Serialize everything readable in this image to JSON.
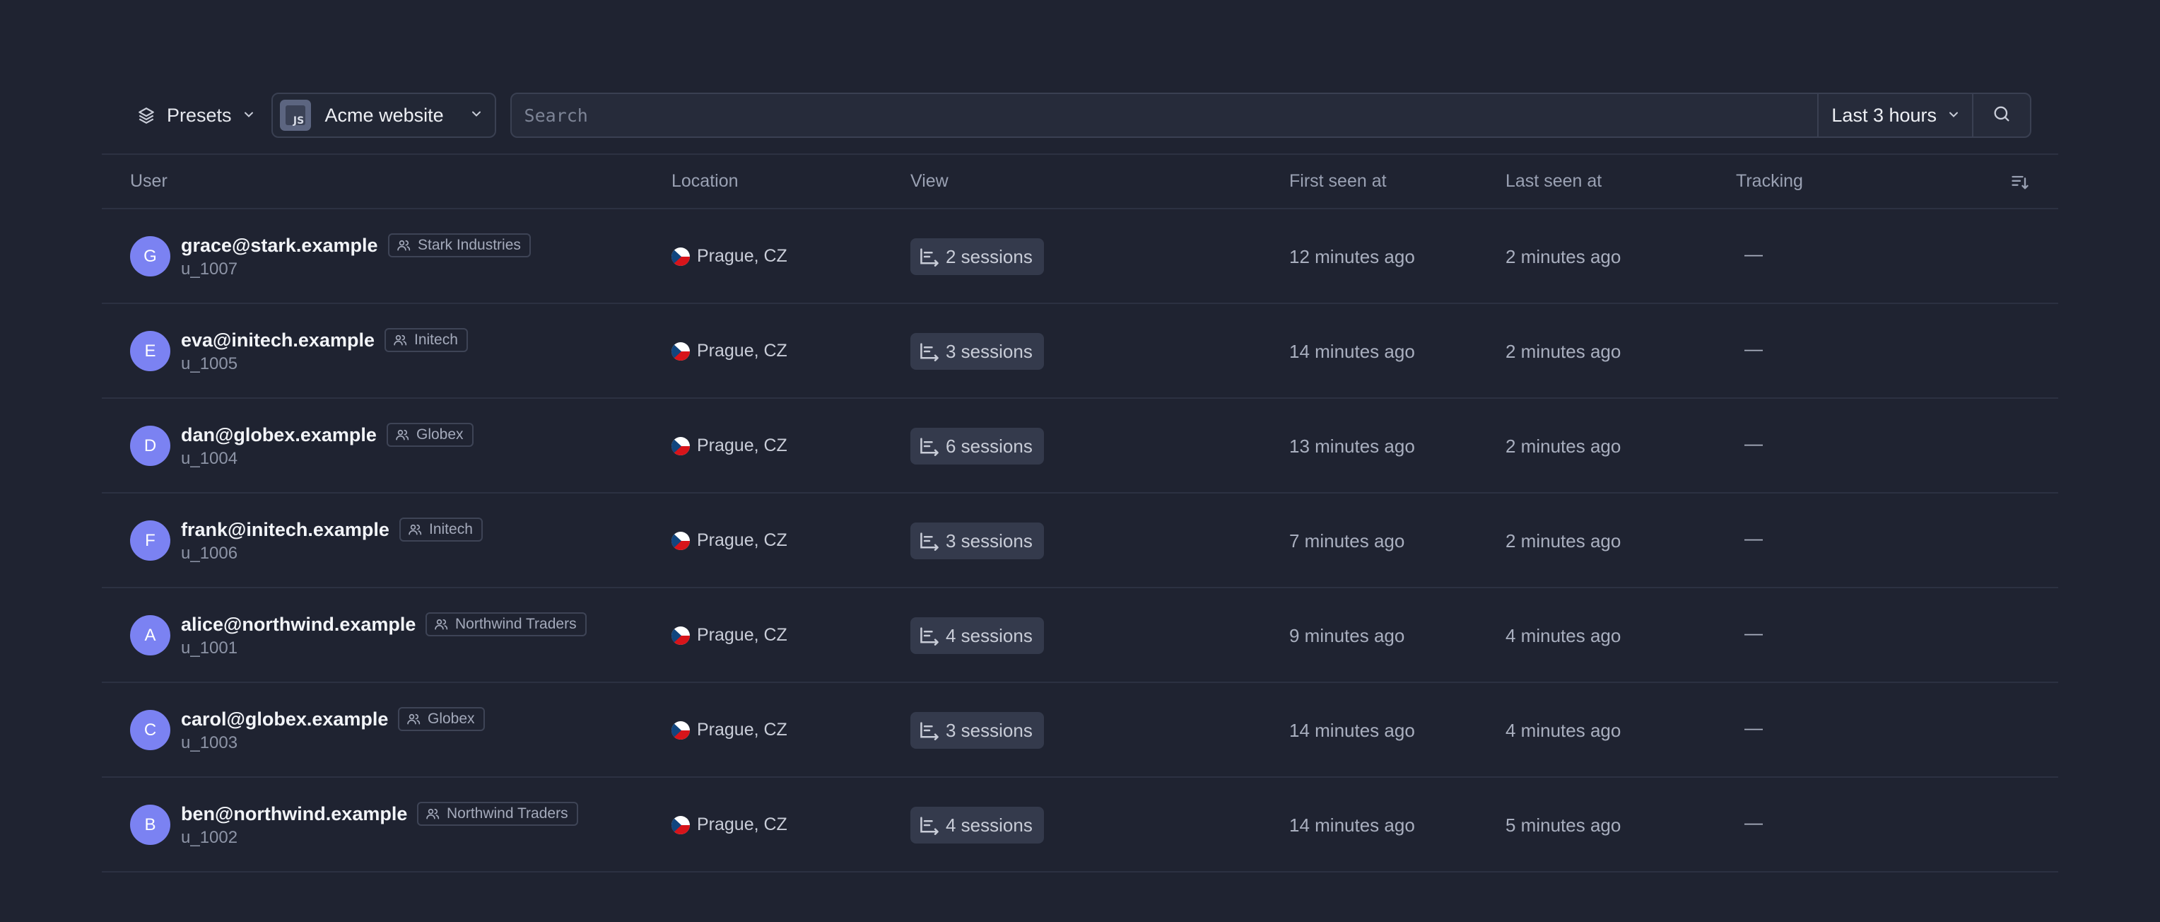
{
  "toolbar": {
    "presets_label": "Presets",
    "project_name": "Acme website",
    "project_logo_text": "JS",
    "search_placeholder": "Search",
    "time_range": "Last 3 hours"
  },
  "table": {
    "columns": {
      "user": "User",
      "location": "Location",
      "view": "View",
      "first_seen": "First seen at",
      "last_seen": "Last seen at",
      "tracking": "Tracking"
    },
    "rows": [
      {
        "initial": "G",
        "email": "grace@stark.example",
        "org": "Stark Industries",
        "uid": "u_1007",
        "location": "Prague, CZ",
        "sessions": "2 sessions",
        "first_seen": "12 minutes ago",
        "last_seen": "2 minutes ago",
        "tracking": "—"
      },
      {
        "initial": "E",
        "email": "eva@initech.example",
        "org": "Initech",
        "uid": "u_1005",
        "location": "Prague, CZ",
        "sessions": "3 sessions",
        "first_seen": "14 minutes ago",
        "last_seen": "2 minutes ago",
        "tracking": "—"
      },
      {
        "initial": "D",
        "email": "dan@globex.example",
        "org": "Globex",
        "uid": "u_1004",
        "location": "Prague, CZ",
        "sessions": "6 sessions",
        "first_seen": "13 minutes ago",
        "last_seen": "2 minutes ago",
        "tracking": "—"
      },
      {
        "initial": "F",
        "email": "frank@initech.example",
        "org": "Initech",
        "uid": "u_1006",
        "location": "Prague, CZ",
        "sessions": "3 sessions",
        "first_seen": "7 minutes ago",
        "last_seen": "2 minutes ago",
        "tracking": "—"
      },
      {
        "initial": "A",
        "email": "alice@northwind.example",
        "org": "Northwind Traders",
        "uid": "u_1001",
        "location": "Prague, CZ",
        "sessions": "4 sessions",
        "first_seen": "9 minutes ago",
        "last_seen": "4 minutes ago",
        "tracking": "—"
      },
      {
        "initial": "C",
        "email": "carol@globex.example",
        "org": "Globex",
        "uid": "u_1003",
        "location": "Prague, CZ",
        "sessions": "3 sessions",
        "first_seen": "14 minutes ago",
        "last_seen": "4 minutes ago",
        "tracking": "—"
      },
      {
        "initial": "B",
        "email": "ben@northwind.example",
        "org": "Northwind Traders",
        "uid": "u_1002",
        "location": "Prague, CZ",
        "sessions": "4 sessions",
        "first_seen": "14 minutes ago",
        "last_seen": "5 minutes ago",
        "tracking": "—"
      }
    ]
  },
  "colors": {
    "background": "#1f2331",
    "avatar": "#7b82f2",
    "session_chip": "#343a4c"
  }
}
